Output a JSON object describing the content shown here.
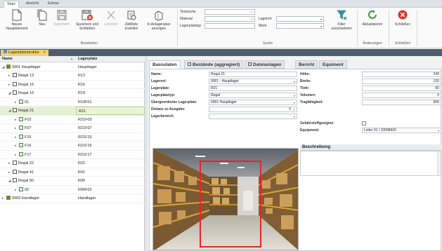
{
  "ribbon_tabs": [
    "Start",
    "Ansicht",
    "Extras"
  ],
  "ribbon": {
    "bearbeiten": {
      "buttons": [
        {
          "label": "Neues\nHauptelement",
          "enabled": true
        },
        {
          "label": "Neu",
          "enabled": true
        },
        {
          "label": "Speichern",
          "enabled": false
        },
        {
          "label": "Speichern und\nSchließen",
          "enabled": true
        },
        {
          "label": "Löschen",
          "enabled": false
        },
        {
          "label": "Zählliste\nerstellen",
          "enabled": true
        },
        {
          "label": "In Anlagenplan\nanzeigen",
          "enabled": true
        }
      ],
      "group_label": "Bearbeiten"
    },
    "suche": {
      "fields": [
        {
          "label": "Textsuche",
          "value": "",
          "marker": "**"
        },
        {
          "label": "Material",
          "value": "",
          "marker": "**"
        },
        {
          "label": "Lagerplatztyp",
          "value": ""
        }
      ],
      "dropdowns": [
        {
          "label": "Lagerort",
          "value": ""
        },
        {
          "label": "Werk",
          "value": ""
        }
      ],
      "filter_label": "Filter\nzurücksetzen",
      "group_label": "Suche"
    },
    "aenderungen": {
      "button": "Aktualisieren",
      "group_label": "Änderungen"
    },
    "schliessen": {
      "button": "Schließen",
      "group_label": "Schließen"
    }
  },
  "doc_tab": {
    "label": "Lagerplatzstruktur",
    "close": "×"
  },
  "tree": {
    "headers": [
      "Name",
      "Lagerplatz"
    ],
    "rows": [
      {
        "name": "0001 Hauptlager",
        "platz": "Hauptlager",
        "level": 0,
        "expander": "◢",
        "icon": "warehouse"
      },
      {
        "name": "Regal 13",
        "platz": "R13",
        "level": 1,
        "expander": "▸",
        "icon": "shelf"
      },
      {
        "name": "Regal 16",
        "platz": "R16",
        "level": 1,
        "expander": "▸",
        "icon": "shelf"
      },
      {
        "name": "Regal 19",
        "platz": "R19",
        "level": 1,
        "expander": "◢",
        "icon": "shelf"
      },
      {
        "name": "01",
        "platz": "R19F01",
        "level": 2,
        "expander": "▸",
        "icon": "compartment"
      },
      {
        "name": "Regal 21",
        "platz": "R21",
        "level": 1,
        "expander": "◢",
        "icon": "shelf",
        "selected": true
      },
      {
        "name": "F03",
        "platz": "R21F03",
        "level": 2,
        "expander": "▸",
        "icon": "compartment"
      },
      {
        "name": "F07",
        "platz": "R21F07",
        "level": 2,
        "expander": "▸",
        "icon": "compartment"
      },
      {
        "name": "F15",
        "platz": "R21F15",
        "level": 2,
        "expander": "▸",
        "icon": "compartment"
      },
      {
        "name": "F16",
        "platz": "R21F16",
        "level": 2,
        "expander": "▸",
        "icon": "compartment"
      },
      {
        "name": "F17",
        "platz": "R21F17",
        "level": 2,
        "expander": "▸",
        "icon": "compartment"
      },
      {
        "name": "Regal 22",
        "platz": "R22",
        "level": 1,
        "expander": "▸",
        "icon": "shelf"
      },
      {
        "name": "Regal 41",
        "platz": "R41",
        "level": 1,
        "expander": "▸",
        "icon": "shelf"
      },
      {
        "name": "Regal 90",
        "platz": "R90",
        "level": 1,
        "expander": "◢",
        "icon": "shelf"
      },
      {
        "name": "02",
        "platz": "R90F02",
        "level": 2,
        "expander": "▸",
        "icon": "compartment"
      },
      {
        "name": "0003 Handlager",
        "platz": "Handlager",
        "level": 0,
        "expander": "▸",
        "icon": "warehouse"
      }
    ]
  },
  "detail_tabs": [
    "Basisdaten",
    "Bestände (aggregiert)",
    "Dateianlagen",
    "Bericht",
    "Equiment"
  ],
  "basisdaten": {
    "left": [
      {
        "label": "Name:",
        "value": "Regal 21",
        "kind": "text"
      },
      {
        "label": "Lagerort:",
        "value": "0001 - Hauptlager",
        "kind": "dropdown"
      },
      {
        "label": "Lagerplatz:",
        "value": "R21",
        "kind": "text"
      },
      {
        "label": "Lagerplatztyp:",
        "value": "Regal",
        "kind": "dropdown"
      },
      {
        "label": "Übergeordneter Lagerplatz:",
        "value": "0001 Hauptlager",
        "kind": "dropdown"
      },
      {
        "label": "Distanz zu Ausgabe:",
        "value": "0",
        "kind": "spin"
      },
      {
        "label": "Lagerbereich:",
        "value": "",
        "kind": "dropdown"
      }
    ],
    "right": [
      {
        "label": "Höhe:",
        "value": "240"
      },
      {
        "label": "Breite:",
        "value": "120"
      },
      {
        "label": "Tiefe:",
        "value": "60"
      },
      {
        "label": "Volumen:",
        "value": "0"
      },
      {
        "label": "Tragfähigkeit:",
        "value": "600"
      }
    ],
    "gefahrstoff_label": "Gefahrstoffgeeignet",
    "gefahrstoff_checked": false,
    "equipment_label": "Equipment:",
    "equipment_value": "Leiter 01 / 10008442",
    "beschreibung_label": "Beschreibung",
    "beschreibung_value": ""
  }
}
